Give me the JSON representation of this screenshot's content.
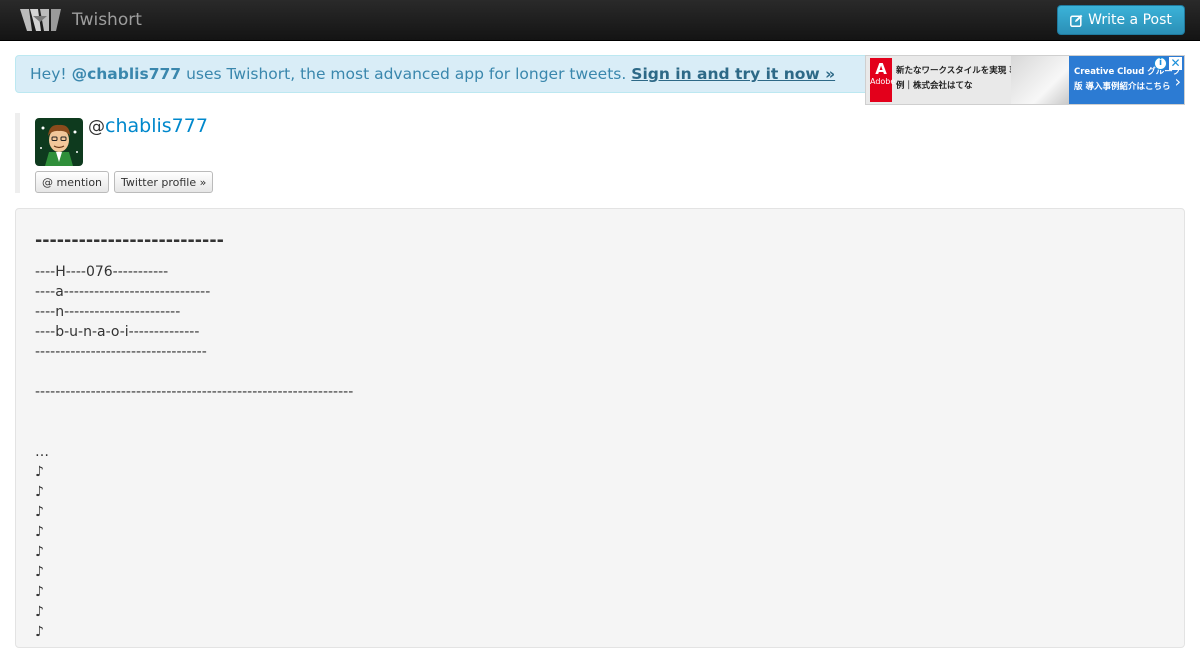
{
  "navbar": {
    "brand": "Twishort",
    "write_button": "Write a Post"
  },
  "banner": {
    "greeting": "Hey!",
    "username": "@chablis777",
    "message": "uses Twishort, the most advanced app for longer tweets.",
    "cta": "Sign in and try it now »"
  },
  "ad": {
    "logo_text": "Adobe",
    "left_text": "新たなワークスタイルを実現 事例｜株式会社はてな",
    "right_text": "Creative Cloud グループ版 導入事例紹介はこちら",
    "choices_icon": "i",
    "close_icon": "✕",
    "arrow_icon": "›"
  },
  "profile": {
    "at": "@",
    "name": "chablis777",
    "mention_button": "@ mention",
    "twitter_button": "Twitter profile »"
  },
  "post": {
    "title": "--------------------------",
    "lines": [
      "----H----076-----------",
      "----a-----------------------------",
      "----n-----------------------",
      "----b-u-n-a-o-i--------------",
      "----------------------------------",
      "",
      "---------------------------------------------------------------",
      "",
      "",
      "…",
      "♪",
      "♪",
      "♪",
      "♪",
      "♪",
      "♪",
      "♪",
      "♪",
      "♪"
    ]
  }
}
